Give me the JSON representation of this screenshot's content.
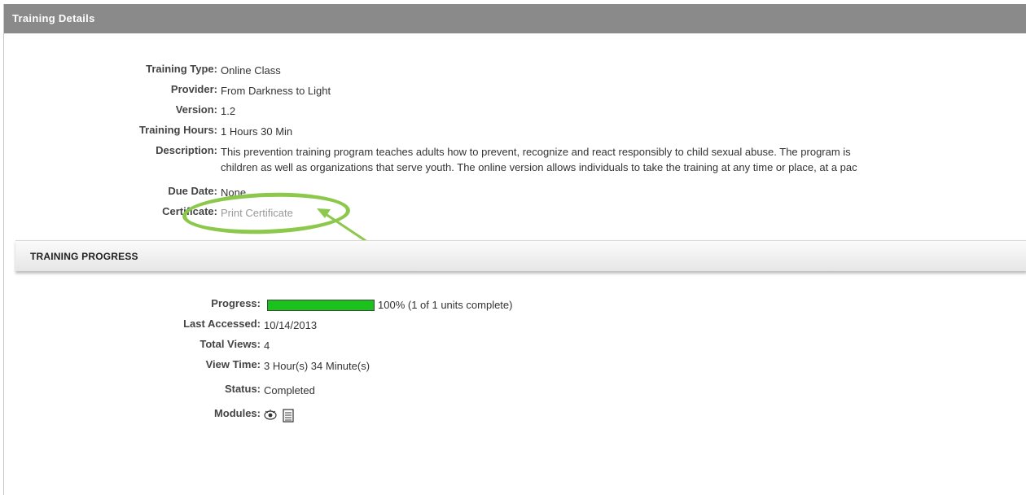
{
  "panel": {
    "title": "Training Details"
  },
  "details": {
    "training_type_label": "Training Type:",
    "training_type_value": "Online Class",
    "provider_label": "Provider:",
    "provider_value": "From Darkness to Light",
    "version_label": "Version:",
    "version_value": "1.2",
    "training_hours_label": "Training Hours:",
    "training_hours_value": "1 Hours 30 Min",
    "description_label": "Description:",
    "description_line1": "This prevention training program teaches adults how to prevent, recognize and react responsibly to child sexual abuse. The program is",
    "description_line2": "children as well as organizations that serve youth. The online version allows individuals to take the training at any time or place, at a pac",
    "due_date_label": "Due Date:",
    "due_date_value": "None",
    "certificate_label": "Certificate:",
    "certificate_link": "Print Certificate"
  },
  "progress_section": {
    "title": "TRAINING PROGRESS",
    "progress_label": "Progress:",
    "progress_fraction": 1.0,
    "progress_text": "100% (1 of 1 units complete)",
    "last_accessed_label": "Last Accessed:",
    "last_accessed_value": "10/14/2013",
    "total_views_label": "Total Views:",
    "total_views_value": "4",
    "view_time_label": "View Time:",
    "view_time_value": "3 Hour(s) 34 Minute(s)",
    "status_label": "Status:",
    "status_value": "Completed",
    "modules_label": "Modules:",
    "module_icons": [
      "view-eye-icon",
      "document-list-icon"
    ]
  },
  "colors": {
    "title_bar": "#8a8a8a",
    "progress_fill": "#1cc21c",
    "annotation": "#8cc84b",
    "link_disabled": "#999999"
  }
}
